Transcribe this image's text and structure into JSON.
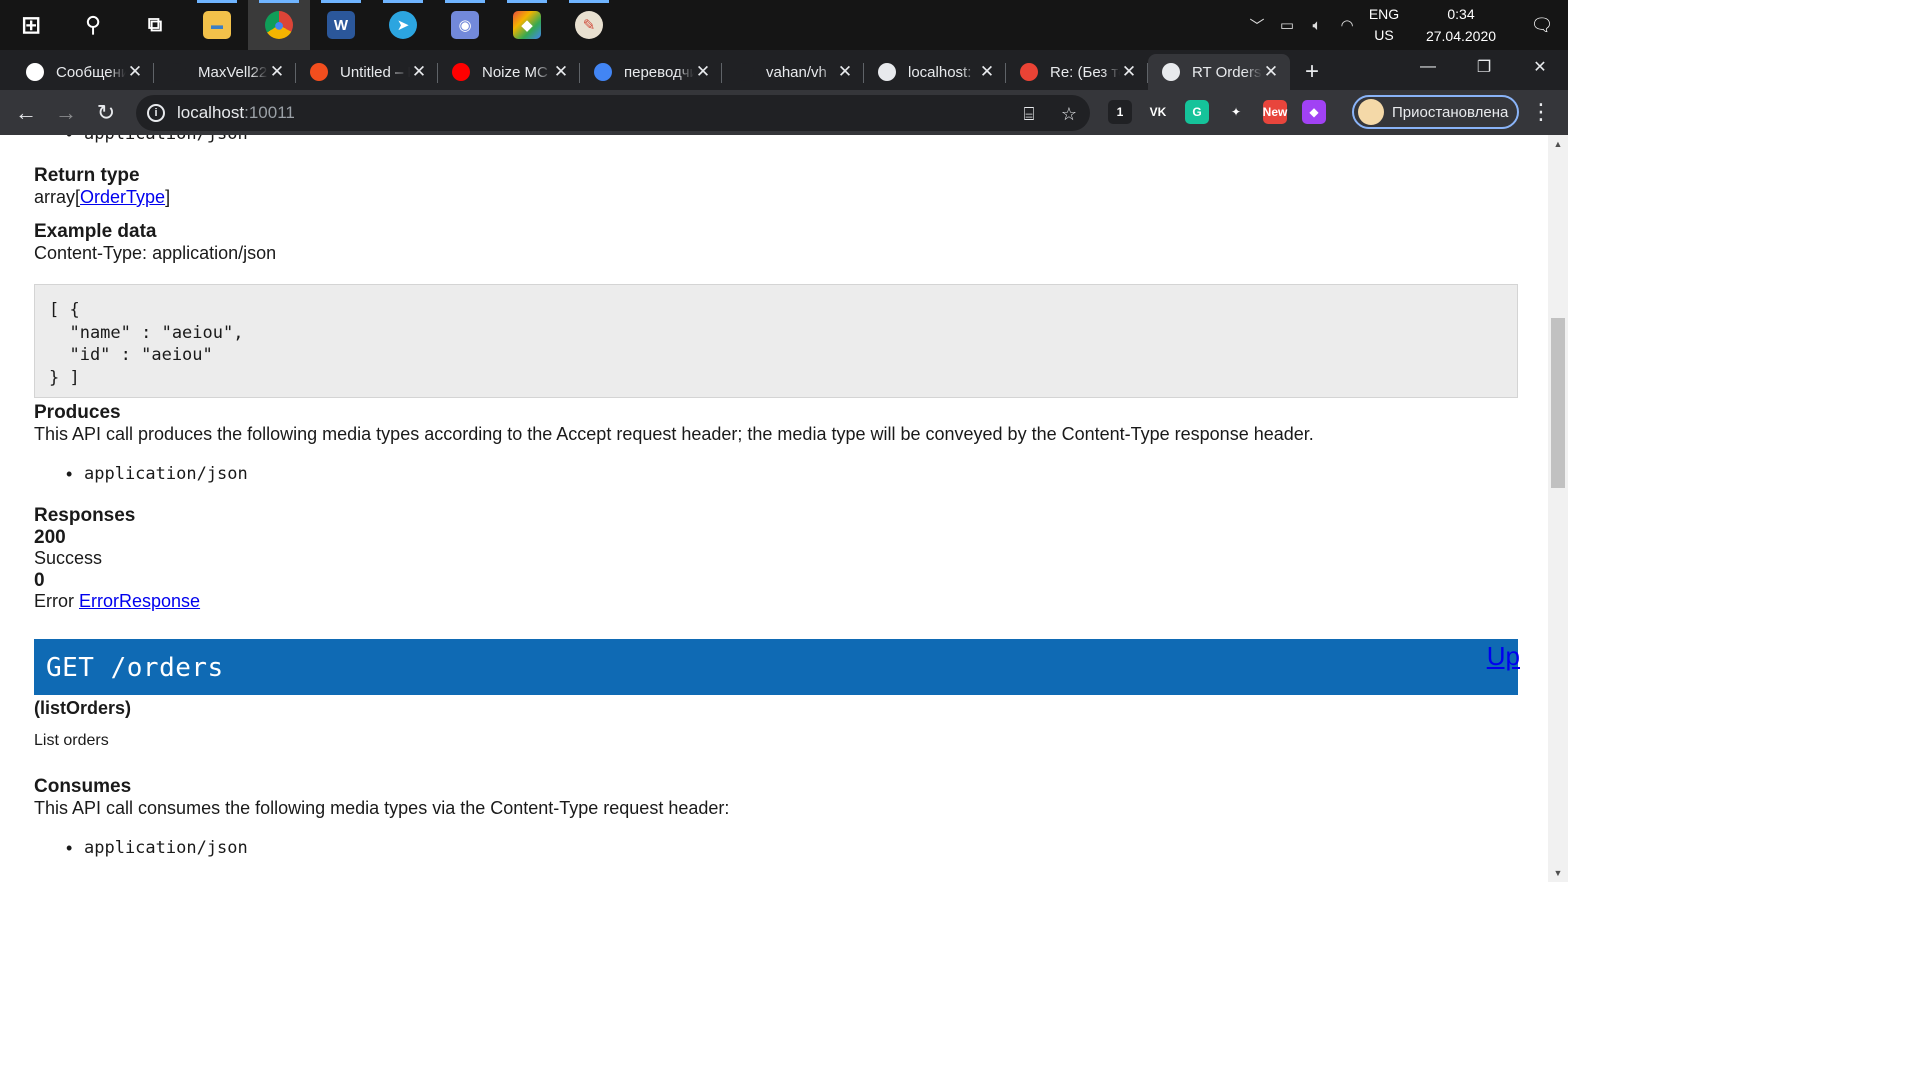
{
  "taskbar": {
    "apps": [
      {
        "name": "start",
        "glyph": "⊞"
      },
      {
        "name": "search",
        "glyph": "⚲"
      },
      {
        "name": "task-view",
        "glyph": "⧉"
      },
      {
        "name": "file-explorer",
        "glyph": "▬"
      },
      {
        "name": "chrome",
        "glyph": "●"
      },
      {
        "name": "word",
        "glyph": "W"
      },
      {
        "name": "telegram",
        "glyph": "➤"
      },
      {
        "name": "discord",
        "glyph": "◉"
      },
      {
        "name": "git",
        "glyph": "◆"
      },
      {
        "name": "paint",
        "glyph": "✎"
      }
    ],
    "tray": {
      "lang_top": "ENG",
      "lang_bottom": "US",
      "time": "0:34",
      "date": "27.04.2020"
    }
  },
  "browser": {
    "tabs": [
      {
        "title": "Сообщения",
        "favicon_color": "#ffffff"
      },
      {
        "title": "MaxVell22",
        "favicon_color": "#202124"
      },
      {
        "title": "Untitled – Figma",
        "favicon_color": "#f24e1e"
      },
      {
        "title": "Noize MC",
        "favicon_color": "#ff0000"
      },
      {
        "title": "переводчик",
        "favicon_color": "#4285f4"
      },
      {
        "title": "vahan/vh",
        "favicon_color": "#202124"
      },
      {
        "title": "localhost:",
        "favicon_color": "#e8eaed"
      },
      {
        "title": "Re: (Без темы)",
        "favicon_color": "#ea4335"
      },
      {
        "title": "RT Orders",
        "favicon_color": "#e8eaed"
      }
    ],
    "address": {
      "host": "localhost",
      "port": ":10011"
    },
    "extensions": [
      {
        "name": "cube-extension",
        "badge": "1",
        "color": "#202124"
      },
      {
        "name": "vk-extension",
        "badge": "VK",
        "color": "#35363a"
      },
      {
        "name": "grammarly-extension",
        "badge": "G",
        "color": "#15c39a"
      },
      {
        "name": "color-extension",
        "badge": "✦",
        "color": "#35363a"
      },
      {
        "name": "new-extension",
        "badge": "New",
        "color": "#e8453c"
      },
      {
        "name": "purple-extension",
        "badge": "◆",
        "color": "#a142f4"
      }
    ],
    "profile_label": "Приостановлена"
  },
  "page": {
    "top_bullet": "application/json",
    "return_type_heading": "Return type",
    "return_type_prefix": "array[",
    "return_type_link": "OrderType",
    "return_type_suffix": "]",
    "example_heading": "Example data",
    "example_content_type": "Content-Type: application/json",
    "example_code": "[ {\n  \"name\" : \"aeiou\",\n  \"id\" : \"aeiou\"\n} ]",
    "produces_heading": "Produces",
    "produces_text": "This API call produces the following media types according to the Accept request header; the media type will be conveyed by the Content-Type response header.",
    "produces_bullet": "application/json",
    "responses_heading": "Responses",
    "resp1_code": "200",
    "resp1_text": "Success",
    "resp2_code": "0",
    "resp2_prefix": "Error ",
    "resp2_link": "ErrorResponse",
    "op_title": "GET /orders",
    "up_link": "Up",
    "op_id": "(listOrders)",
    "op_desc": "List orders",
    "consumes_heading": "Consumes",
    "consumes_text": "This API call consumes the following media types via the Content-Type request header:",
    "consumes_bullet": "application/json"
  },
  "colors": {
    "op_bar": "#0f6ab4",
    "link": "#0000ee",
    "code_bg": "#ececec"
  }
}
